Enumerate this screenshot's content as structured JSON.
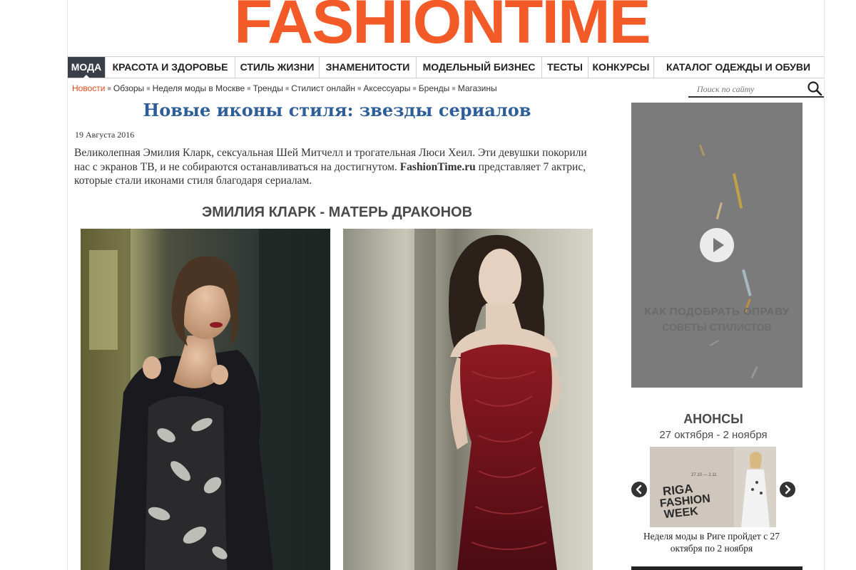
{
  "logo": {
    "text": "FASHIONTIME",
    "color": "#f25a27"
  },
  "main_nav": {
    "items": [
      {
        "label": "МОДА",
        "active": true
      },
      {
        "label": "КРАСОТА И ЗДОРОВЬЕ"
      },
      {
        "label": "СТИЛЬ ЖИЗНИ"
      },
      {
        "label": "ЗНАМЕНИТОСТИ"
      },
      {
        "label": "МОДЕЛЬНЫЙ БИЗНЕС"
      },
      {
        "label": "ТЕСТЫ"
      },
      {
        "label": "КОНКУРСЫ"
      },
      {
        "label": "КАТАЛОГ ОДЕЖДЫ И ОБУВИ"
      }
    ]
  },
  "sub_nav": {
    "items": [
      {
        "label": "Новости",
        "current": true
      },
      {
        "label": "Обзоры"
      },
      {
        "label": "Неделя моды в Москве"
      },
      {
        "label": "Тренды"
      },
      {
        "label": "Стилист онлайн"
      },
      {
        "label": "Аксессуары"
      },
      {
        "label": "Бренды"
      },
      {
        "label": "Магазины"
      }
    ]
  },
  "search": {
    "placeholder": "Поиск по сайту",
    "icon": "search-icon"
  },
  "article": {
    "title": "Новые иконы стиля: звезды сериалов",
    "date": "19 Августа 2016",
    "lead_text": "Великолепная Эмилия Кларк, сексуальная Шей Митчелл и трогательная Люси Хеил. Эти девушки покорили нас с экранов ТВ, и не собираются останавливаться на достигнутом.",
    "lead_site": "FashionTime.ru",
    "lead_rest": " представляет 7 актрис, которые стали иконами стиля благодаря сериалам.",
    "section_heading": "ЭМИЛИЯ КЛАРК - МАТЕРЬ ДРАКОНОВ"
  },
  "sidebar": {
    "video": {
      "caption_1": "КАК ПОДОБРАТЬ ОПРАВУ",
      "caption_2": "СОВЕТЫ СТИЛИСТОВ"
    },
    "anons": {
      "title": "АНОНСЫ",
      "dates": "27 октября - 2 ноября",
      "banner_text": "RIGA FASHION WEEK",
      "banner_dates": "27.10 — 2.11",
      "caption": "Неделя моды в Риге пройдет с 27 октября по 2 ноября"
    }
  }
}
